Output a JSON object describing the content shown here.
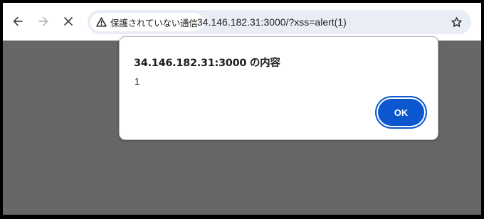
{
  "toolbar": {
    "back_icon": "arrow-left-icon",
    "forward_icon": "arrow-right-icon",
    "stop_icon": "close-icon",
    "bookmark_icon": "star-icon"
  },
  "omnibox": {
    "security_label": "保護されていない通信",
    "security_icon": "warning-triangle-icon",
    "url": "34.146.182.31:3000/?xss=alert(1)"
  },
  "dialog": {
    "title": "34.146.182.31:3000 の内容",
    "message": "1",
    "ok_label": "OK"
  },
  "colors": {
    "page_overlay": "#676767",
    "omnibox_bg": "#e9eef6",
    "accent": "#0b57d0",
    "outer_frame": "#000000"
  }
}
